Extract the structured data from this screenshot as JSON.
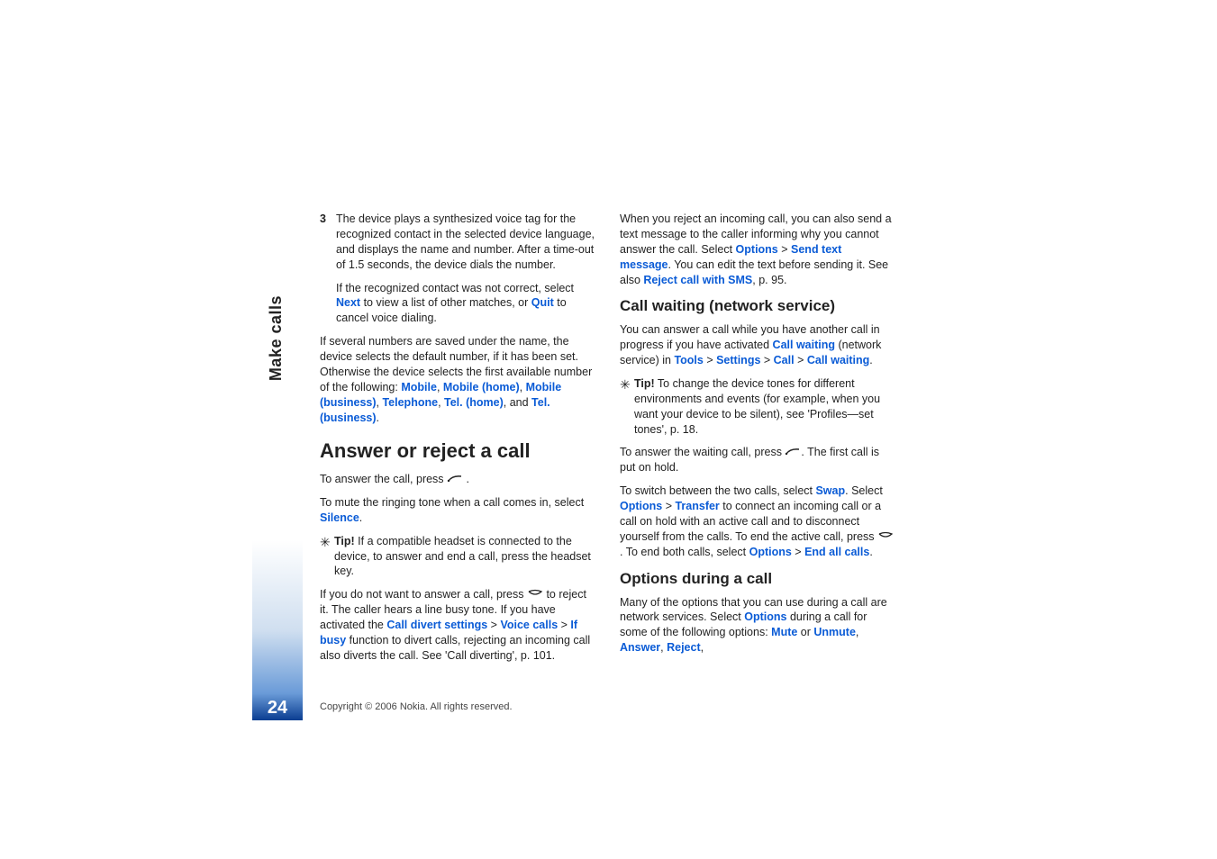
{
  "sidebar": {
    "section_label": "Make calls",
    "page_number": "24"
  },
  "col1": {
    "step3_num": "3",
    "step3_a": "The device plays a synthesized voice tag for the recognized contact in the selected device language, and displays the name and number. After a time-out of 1.5 seconds, the device dials the number.",
    "step3_b_pre": "If the recognized contact was not correct, select ",
    "step3_next": "Next",
    "step3_b_mid": " to view a list of other matches, or ",
    "step3_quit": "Quit",
    "step3_b_post": " to cancel voice dialing.",
    "multi_a": "If several numbers are saved under the name, the device selects the default number, if it has been set. Otherwise the device selects the first available number of the following: ",
    "m_mobile": "Mobile",
    "m_mobile_home": "Mobile (home)",
    "m_mobile_biz": "Mobile (business)",
    "m_tel": "Telephone",
    "m_tel_home": "Tel. (home)",
    "m_tel_biz": "Tel. (business)",
    "h_answer": "Answer or reject a call",
    "answer_call": "To answer the call, press ",
    "mute_a": "To mute the ringing tone when a call comes in, select ",
    "silence": "Silence",
    "tip_label": "Tip!",
    "tip1_text": " If a compatible headset is connected to the device, to answer and end a call, press the headset key.",
    "reject_a": "If you do not want to answer a call, press ",
    "reject_b": " to reject it. The caller hears a line busy tone. If you have activated the ",
    "cds": "Call divert settings",
    "vc": "Voice calls",
    "ifbusy": "If busy",
    "reject_c": " function to divert calls, rejecting an incoming call also diverts the call. See 'Call diverting',  p. 101."
  },
  "col2": {
    "rej_a": "When you reject an incoming call, you can also send a text message to the caller informing why you cannot answer the call. Select ",
    "options": "Options",
    "stm": "Send text message",
    "rej_b": ". You can edit the text before sending it. See also ",
    "rcws": "Reject call with SMS",
    "rej_c": ", p. 95.",
    "h_cw": "Call waiting (network service)",
    "cw_a": "You can answer a call while you have another call in progress if you have activated ",
    "cw_label": "Call waiting",
    "cw_b": " (network service) in ",
    "tools": "Tools",
    "settings": "Settings",
    "call": "Call",
    "tip_label": "Tip!",
    "tip2_text": " To change the device tones for different environments and events (for example, when you want your device to be silent), see 'Profiles—set tones', p. 18.",
    "wait_a": "To answer the waiting call, press ",
    "wait_b": ". The first call is put on hold.",
    "switch_a": "To switch between the two calls, select ",
    "swap": "Swap",
    "switch_b": ". Select ",
    "transfer": "Transfer",
    "switch_c": " to connect an incoming call or a call on hold with an active call and to disconnect yourself from the calls. To end the active call, press ",
    "switch_d": ". To end both calls, select ",
    "eac": "End all calls",
    "h_opt": "Options during a call",
    "opt_a": "Many of the options that you can use during a call are network services. Select ",
    "opt_b": " during a call for some of the following options: ",
    "mute": "Mute",
    "unmute": "Unmute",
    "answer": "Answer",
    "reject": "Reject",
    "or": " or ",
    "comma": ", "
  },
  "footer": "Copyright © 2006 Nokia. All rights reserved.",
  "sep": " > ",
  "period": "."
}
